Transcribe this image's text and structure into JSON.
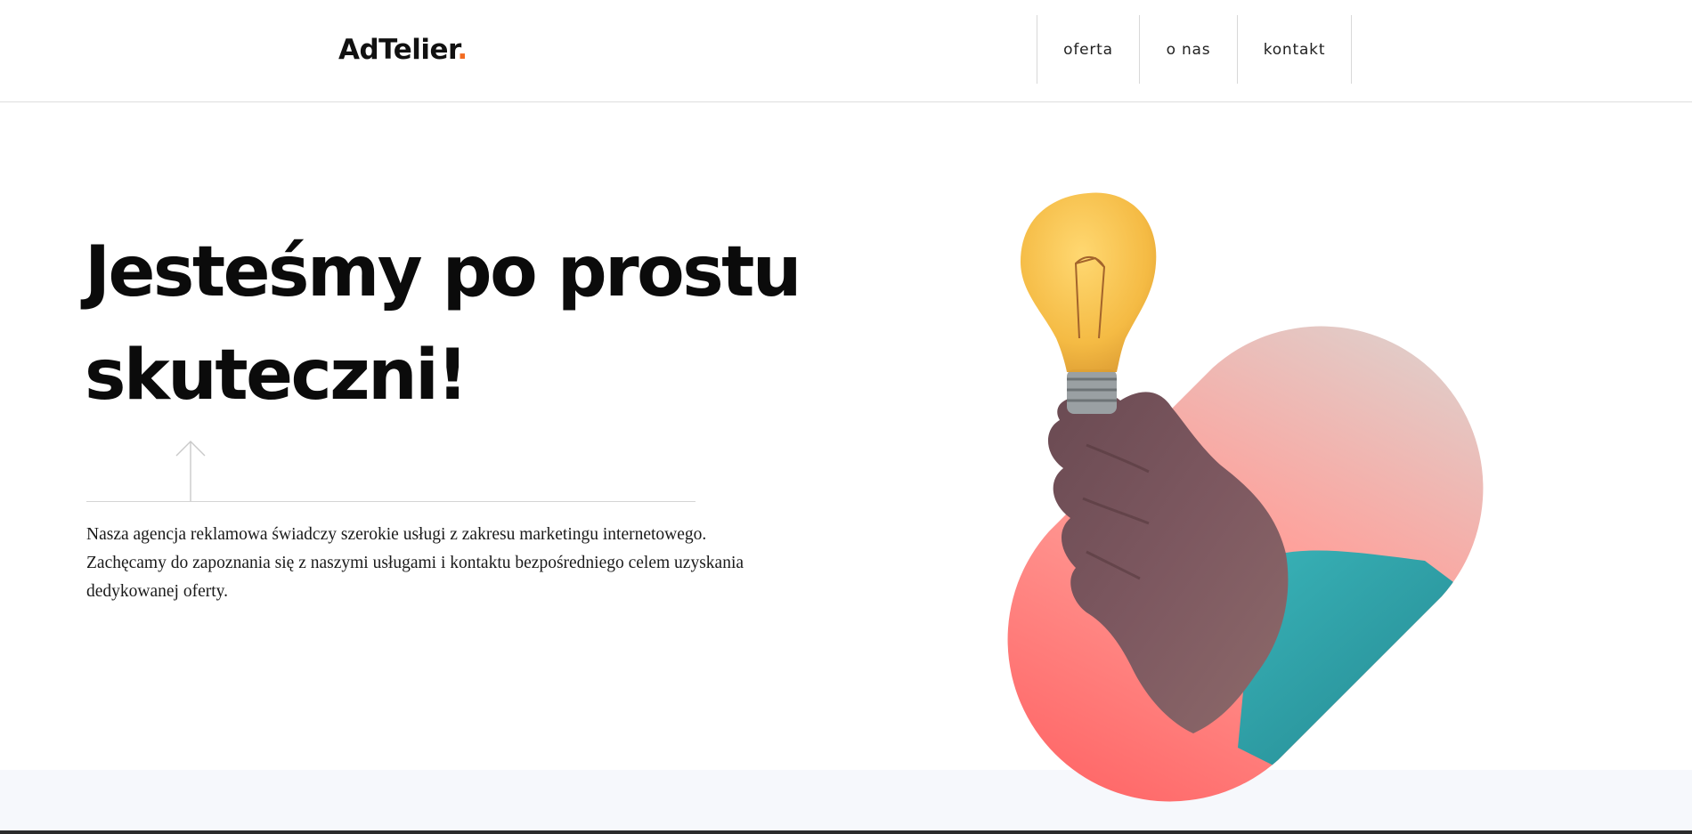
{
  "header": {
    "logo_text": "AdTelier",
    "logo_dot": ".",
    "nav": [
      {
        "label": "oferta"
      },
      {
        "label": "o nas"
      },
      {
        "label": "kontakt"
      }
    ]
  },
  "hero": {
    "title_line1": "Jesteśmy po prostu",
    "title_line2": "skuteczni!",
    "description_line1": "Nasza agencja reklamowa świadczy szerokie usługi z zakresu marketingu internetowego.",
    "description_line2": "Zachęcamy do zapoznania się z naszymi usługami i kontaktu bezpośredniego celem uzyskania",
    "description_line3": "dedykowanej oferty."
  },
  "colors": {
    "accent": "#f26b21",
    "blob_top": "#e6c8c4",
    "blob_bottom": "#ff7070",
    "bulb": "#f5c242",
    "sleeve": "#2a9fa8",
    "bottom_strip": "#f6f8fc"
  },
  "icons": {
    "scroll": "arrow-up-icon",
    "illustration": "lightbulb-hand-illustration"
  }
}
